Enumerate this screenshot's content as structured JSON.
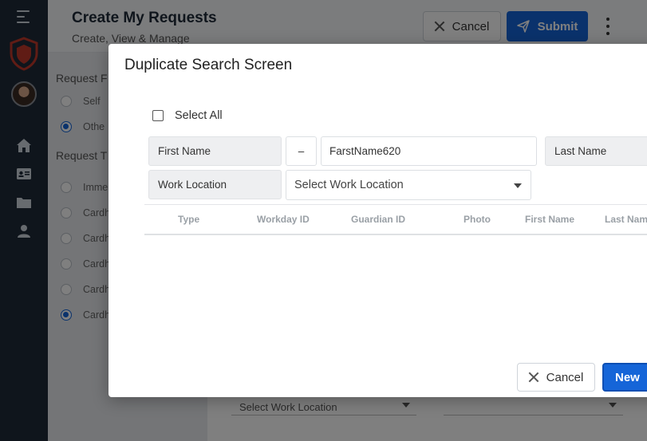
{
  "page": {
    "title": "Create My Requests",
    "subtitle": "Create, View & Manage",
    "cancel_label": "Cancel",
    "submit_label": "Submit",
    "request_for_label": "Request F",
    "request_for_options": [
      "Self",
      "Othe"
    ],
    "request_type_label": "Request T",
    "request_type_options": [
      "Imme",
      "Cardh",
      "Cardh",
      "Cardh",
      "Cardh",
      "Cardh"
    ],
    "bg_work_location_placeholder": "Select Work Location"
  },
  "dialog": {
    "title": "Duplicate Search Screen",
    "select_all_label": "Select All",
    "first_name_label": "First Name",
    "operator": "–",
    "first_name_value": "FarstName620",
    "last_name_label": "Last Name",
    "work_location_label": "Work Location",
    "work_location_placeholder": "Select Work Location",
    "columns": [
      "Type",
      "Workday ID",
      "Guardian ID",
      "Photo",
      "First Name",
      "Last Nam"
    ],
    "cancel_label": "Cancel",
    "new_label": "New"
  },
  "colors": {
    "primary": "#1565d8",
    "sidebar": "#1f2a38",
    "shield": "#c0392b"
  },
  "icons": [
    "menu-icon",
    "shield-logo-icon",
    "home-icon",
    "id-card-icon",
    "folder-icon",
    "user-icon",
    "close-icon",
    "send-icon",
    "more-vertical-icon",
    "chevron-down-icon"
  ]
}
